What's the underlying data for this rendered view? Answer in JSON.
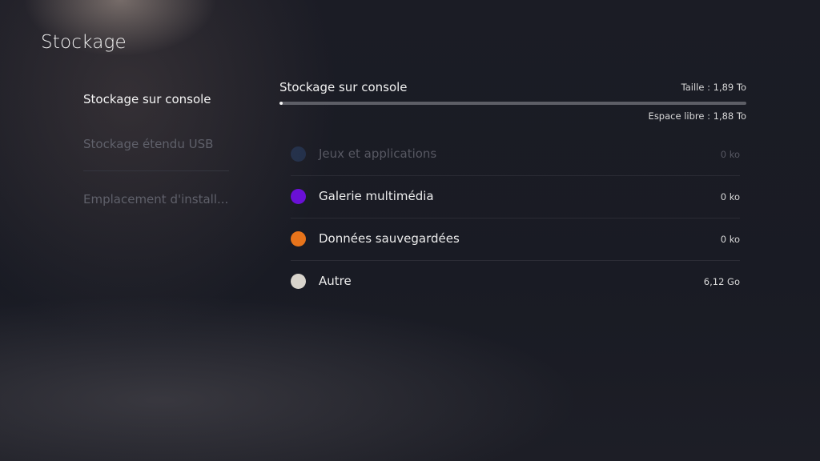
{
  "page": {
    "title": "Stockage"
  },
  "sidebar": {
    "items": [
      {
        "label": "Stockage sur console",
        "state": "selected"
      },
      {
        "label": "Stockage étendu USB",
        "state": "disabled"
      },
      {
        "label": "Emplacement d'install...",
        "state": "disabled"
      }
    ]
  },
  "main": {
    "title": "Stockage sur console",
    "size_text": "Taille : 1,89 To",
    "free_text": "Espace libre : 1,88 To",
    "used_fraction": 0.006,
    "categories": [
      {
        "label": "Jeux et applications",
        "value": "0 ko",
        "color": "#2f4a78",
        "enabled": false
      },
      {
        "label": "Galerie multimédia",
        "value": "0 ko",
        "color": "#6a10d6",
        "enabled": true
      },
      {
        "label": "Données sauvegardées",
        "value": "0 ko",
        "color": "#e7741b",
        "enabled": true
      },
      {
        "label": "Autre",
        "value": "6,12 Go",
        "color": "#d8d4cc",
        "enabled": true
      }
    ]
  }
}
